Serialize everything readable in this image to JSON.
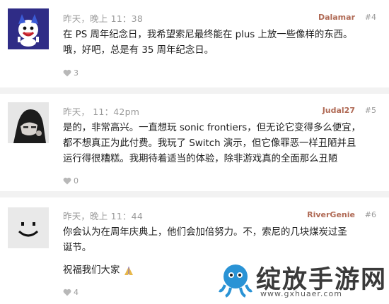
{
  "posts": [
    {
      "date": "昨天，晚上 11：38",
      "username": "Dalamar",
      "post_number": "#4",
      "lines": [
        "在 PS 周年纪念日，我希望索尼最终能在 plus 上放一些像样的东西。",
        "哦，好吧，总是有 35 周年纪念日。"
      ],
      "likes": "3",
      "avatar": "jack-frost-avatar"
    },
    {
      "date": "昨天，  11：42pm",
      "username": "Judal27",
      "post_number": "#5",
      "lines": [
        "是的，非常高兴。一直想玩 sonic frontiers，但无论它变得多么便宜，",
        "都不想真正为此付费。我玩了 Switch 演示，但它像罪恶一样丑陋并且",
        "运行得很糟糕。我期待着适当的体验，除非游戏真的全面那么丑陋"
      ],
      "likes": "0",
      "avatar": "dark-character-avatar"
    },
    {
      "date": "昨天，晚上 11：44",
      "username": "RiverGenie",
      "post_number": "#6",
      "lines": [
        "你会认为在周年庆典上，他们会加倍努力。不，索尼的几块煤炭过圣",
        "诞节。"
      ],
      "extra_line": "祝福我们大家",
      "likes": "4",
      "avatar": "smiley-avatar"
    }
  ],
  "watermark": {
    "title": "绽放手游网",
    "url": "www.gxhuaer.com"
  },
  "colors": {
    "username": "#b06a55",
    "meta": "#9a9a9a",
    "separator": "#f2f2f2"
  }
}
